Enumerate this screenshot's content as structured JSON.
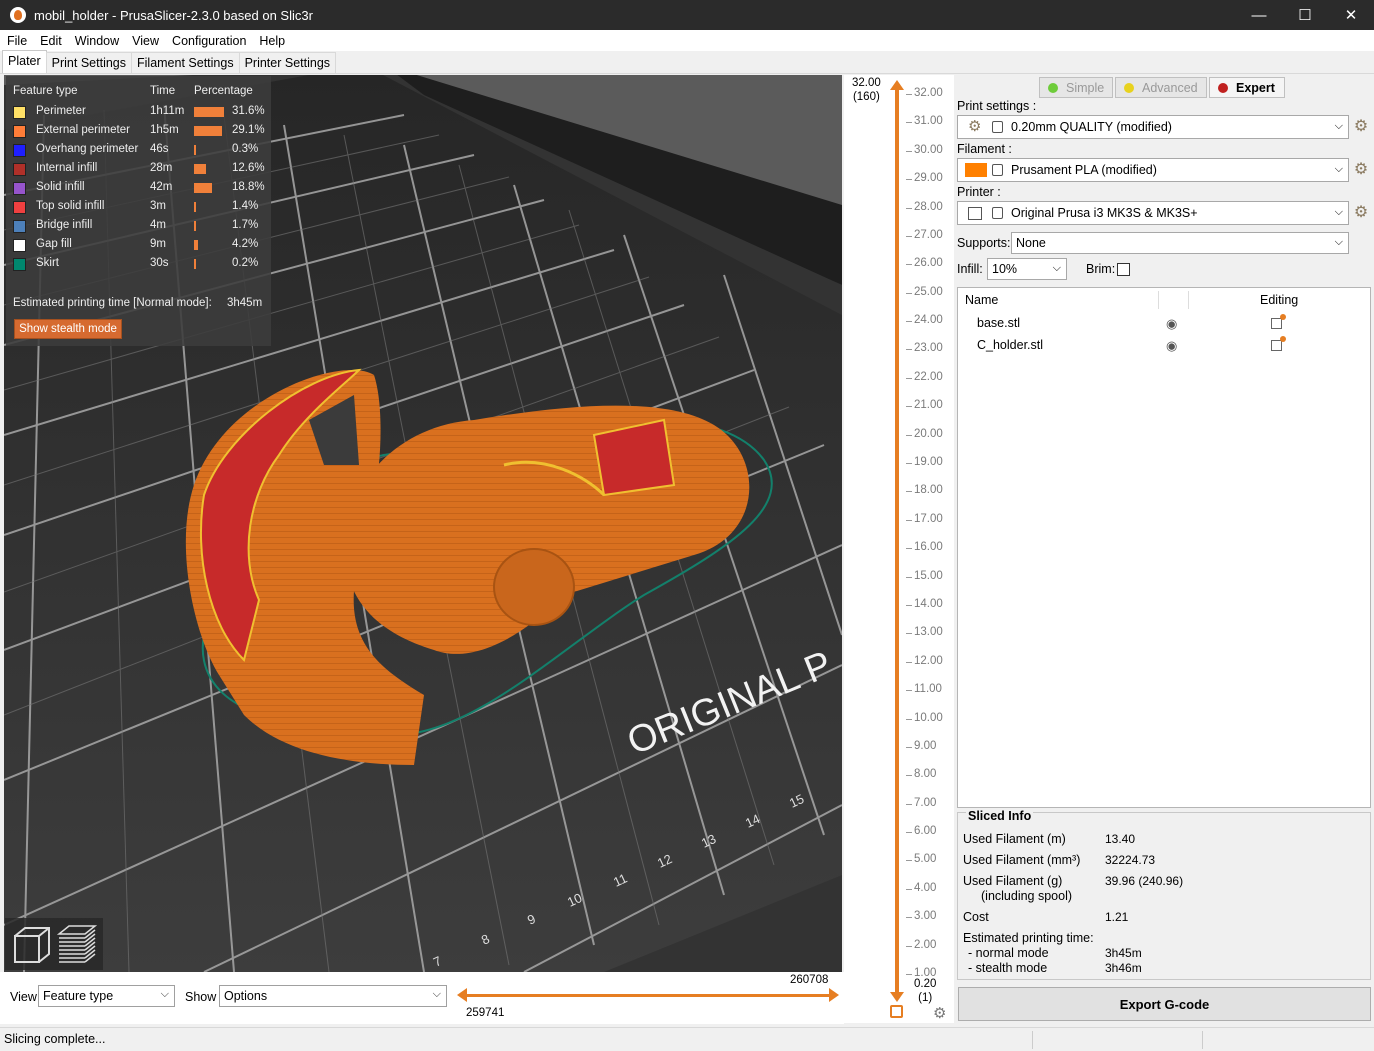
{
  "window": {
    "title": "mobil_holder - PrusaSlicer-2.3.0 based on Slic3r",
    "controls": {
      "minimize": "—",
      "maximize": "☐",
      "close": "✕"
    }
  },
  "menu": [
    "File",
    "Edit",
    "Window",
    "View",
    "Configuration",
    "Help"
  ],
  "tabs": [
    "Plater",
    "Print Settings",
    "Filament Settings",
    "Printer Settings"
  ],
  "legend": {
    "headers": {
      "feature": "Feature type",
      "time": "Time",
      "percentage": "Percentage"
    },
    "rows": [
      {
        "name": "Perimeter",
        "time": "1h11m",
        "pct": "31.6%",
        "color": "#ffe066",
        "fraction": 0.316
      },
      {
        "name": "External perimeter",
        "time": "1h5m",
        "pct": "29.1%",
        "color": "#ff7d38",
        "fraction": 0.291
      },
      {
        "name": "Overhang perimeter",
        "time": "46s",
        "pct": "0.3%",
        "color": "#1f1fff",
        "fraction": 0.003
      },
      {
        "name": "Internal infill",
        "time": "28m",
        "pct": "12.6%",
        "color": "#b03029",
        "fraction": 0.126
      },
      {
        "name": "Solid infill",
        "time": "42m",
        "pct": "18.8%",
        "color": "#9654cc",
        "fraction": 0.188
      },
      {
        "name": "Top solid infill",
        "time": "3m",
        "pct": "1.4%",
        "color": "#f04040",
        "fraction": 0.014
      },
      {
        "name": "Bridge infill",
        "time": "4m",
        "pct": "1.7%",
        "color": "#4d80ba",
        "fraction": 0.017
      },
      {
        "name": "Gap fill",
        "time": "9m",
        "pct": "4.2%",
        "color": "#ffffff",
        "fraction": 0.042
      },
      {
        "name": "Skirt",
        "time": "30s",
        "pct": "0.2%",
        "color": "#00876e",
        "fraction": 0.002
      }
    ],
    "estimated_label": "Estimated printing time [Normal mode]:",
    "estimated_value": "3h45m",
    "stealth_button": "Show stealth mode"
  },
  "bed": {
    "brand_text": "ORIGINAL P",
    "ruler": [
      "7",
      "8",
      "9",
      "10",
      "11",
      "12",
      "13",
      "14",
      "15"
    ]
  },
  "layer_slider": {
    "top_value": "32.00",
    "top_layer": "(160)",
    "bottom_value": "0.20",
    "bottom_layer": "(1)",
    "ticks": [
      "32.00",
      "31.00",
      "30.00",
      "29.00",
      "28.00",
      "27.00",
      "26.00",
      "25.00",
      "24.00",
      "23.00",
      "22.00",
      "21.00",
      "20.00",
      "19.00",
      "18.00",
      "17.00",
      "16.00",
      "15.00",
      "14.00",
      "13.00",
      "12.00",
      "11.00",
      "10.00",
      "9.00",
      "8.00",
      "7.00",
      "6.00",
      "5.00",
      "4.00",
      "3.00",
      "2.00",
      "1.00"
    ]
  },
  "bottom": {
    "view_label": "View",
    "view_value": "Feature type",
    "show_label": "Show",
    "show_value": "Options",
    "move_left": "259741",
    "move_right": "260708"
  },
  "modes": [
    {
      "label": "Simple",
      "color": "#6ecc3a"
    },
    {
      "label": "Advanced",
      "color": "#e8d21e"
    },
    {
      "label": "Expert",
      "color": "#c0201f"
    }
  ],
  "presets": {
    "print_label": "Print settings :",
    "print_value": "0.20mm QUALITY (modified)",
    "filament_label": "Filament :",
    "filament_value": "Prusament PLA (modified)",
    "filament_color": "#ff8000",
    "printer_label": "Printer :",
    "printer_value": "Original Prusa i3 MK3S & MK3S+",
    "supports_label": "Supports:",
    "supports_value": "None",
    "infill_label": "Infill:",
    "infill_value": "10%",
    "brim_label": "Brim:"
  },
  "objects": {
    "col_name": "Name",
    "col_editing": "Editing",
    "items": [
      "base.stl",
      "C_holder.stl"
    ]
  },
  "sliced_info": {
    "title": "Sliced Info",
    "used_m_label": "Used Filament (m)",
    "used_m": "13.40",
    "used_mm3_label": "Used Filament (mm³)",
    "used_mm3": "32224.73",
    "used_g_label": "Used Filament (g)",
    "used_g_sub": "(including spool)",
    "used_g": "39.96 (240.96)",
    "cost_label": "Cost",
    "cost": "1.21",
    "time_label": "Estimated printing time:",
    "normal_label": "- normal mode",
    "normal": "3h45m",
    "stealth_label": "- stealth mode",
    "stealth": "3h46m"
  },
  "export_button": "Export G-code",
  "status": "Slicing complete..."
}
